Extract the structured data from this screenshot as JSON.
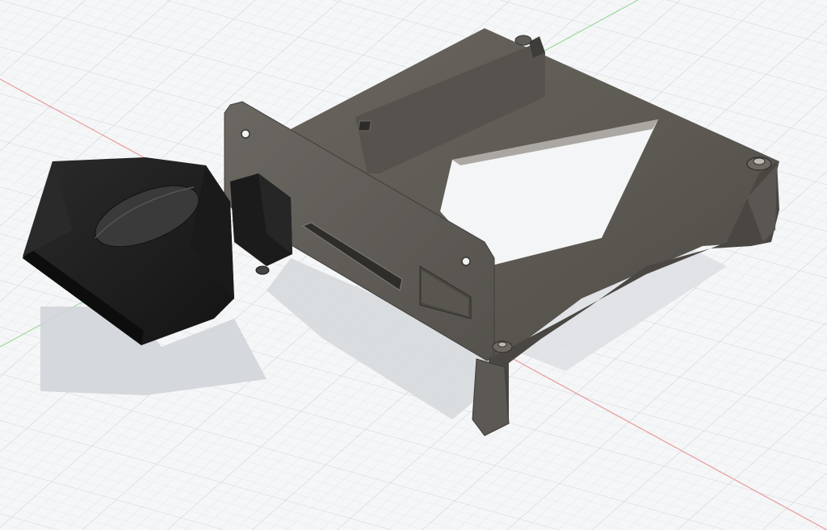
{
  "viewport": {
    "background": "#f5f6f7",
    "grid_color": "#d7dbe0",
    "grid_major_color": "#c4c9cf",
    "x_axis_color": "#e88a8a",
    "y_axis_color": "#8fd48f"
  },
  "model": {
    "body_color": "#5d5a55",
    "body_light": "#6f6b65",
    "body_dark": "#3f3d3a",
    "knob_color": "#1f1f1f",
    "shadow_color": "#cfd2d5"
  },
  "icons": [
    "mounting-hole-icon"
  ]
}
